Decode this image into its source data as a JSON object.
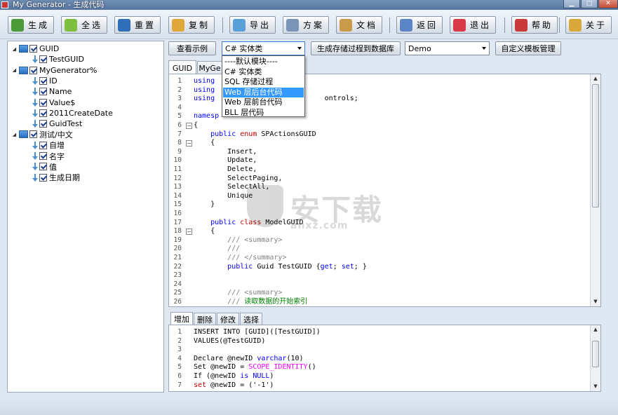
{
  "window": {
    "title": "My Generator - 生成代码"
  },
  "toolbar": {
    "buttons": [
      {
        "id": "generate",
        "label": "生成",
        "color": "#4a9a3a"
      },
      {
        "id": "select_all",
        "label": "全选",
        "color": "#7fbf3f"
      },
      {
        "id": "reset",
        "label": "重置",
        "color": "#2e6fb8"
      },
      {
        "id": "copy",
        "label": "复制",
        "color": "#e0a83a"
      },
      {
        "id": "export",
        "label": "导出",
        "color": "#5aa0d8"
      },
      {
        "id": "scheme",
        "label": "方案",
        "color": "#7a94b8"
      },
      {
        "id": "docs",
        "label": "文档",
        "color": "#c89a4a"
      },
      {
        "id": "back",
        "label": "返回",
        "color": "#5a86c8"
      },
      {
        "id": "exit",
        "label": "退出",
        "color": "#d83a4a"
      },
      {
        "id": "help",
        "label": "帮助",
        "color": "#c83a3a"
      },
      {
        "id": "about",
        "label": "关于",
        "color": "#d8a83a"
      }
    ]
  },
  "tree": {
    "nodes": [
      {
        "label": "GUID",
        "level": 0,
        "kind": "table",
        "expanded": true
      },
      {
        "label": "TestGUID",
        "level": 1,
        "kind": "field"
      },
      {
        "label": "MyGenerator%",
        "level": 0,
        "kind": "table",
        "expanded": true
      },
      {
        "label": "ID",
        "level": 1,
        "kind": "field"
      },
      {
        "label": "Name",
        "level": 1,
        "kind": "field"
      },
      {
        "label": "Value$",
        "level": 1,
        "kind": "field"
      },
      {
        "label": "2011CreateDate",
        "level": 1,
        "kind": "field"
      },
      {
        "label": "GuidTest",
        "level": 1,
        "kind": "field"
      },
      {
        "label": "测试/中文",
        "level": 0,
        "kind": "table",
        "expanded": true
      },
      {
        "label": "自增",
        "level": 1,
        "kind": "field"
      },
      {
        "label": "名字",
        "level": 1,
        "kind": "field"
      },
      {
        "label": "值",
        "level": 1,
        "kind": "field"
      },
      {
        "label": "生成日期",
        "level": 1,
        "kind": "field"
      }
    ]
  },
  "controls": {
    "view_sample": "查看示例",
    "template_combo": "C# 实体类",
    "gen_proc_button": "生成存储过程到数据库",
    "db_combo": "Demo",
    "custom_template_button": "自定义模板管理"
  },
  "dropdown": {
    "items": [
      "----默认模块----",
      "C# 实体类",
      "SQL 存储过程",
      "Web 层后台代码",
      "Web 层前台代码",
      "BLL 层代码"
    ],
    "highlighted_index": 3
  },
  "top_tabs": [
    "GUID",
    "MyGe"
  ],
  "code": {
    "lines": [
      {
        "n": "1",
        "fold": "",
        "segs": [
          [
            "kw",
            "using"
          ],
          [
            "",
            "  "
          ]
        ]
      },
      {
        "n": "2",
        "fold": "",
        "segs": [
          [
            "kw",
            "using"
          ]
        ]
      },
      {
        "n": "3",
        "fold": "",
        "segs": [
          [
            "kw",
            "using"
          ],
          [
            "",
            "                          ontrols;"
          ]
        ]
      },
      {
        "n": "4",
        "fold": "",
        "segs": []
      },
      {
        "n": "5",
        "fold": "",
        "segs": [
          [
            "kw",
            "namesp"
          ],
          [
            "",
            " "
          ]
        ]
      },
      {
        "n": "6",
        "fold": "−",
        "segs": [
          [
            "",
            "{"
          ]
        ]
      },
      {
        "n": "7",
        "fold": "",
        "segs": [
          [
            "",
            "    "
          ],
          [
            "kw",
            "public"
          ],
          [
            "",
            " "
          ],
          [
            "kw2",
            "enum"
          ],
          [
            "",
            " SPActionsGUID"
          ]
        ]
      },
      {
        "n": "8",
        "fold": "−",
        "segs": [
          [
            "",
            "    {"
          ]
        ]
      },
      {
        "n": "9",
        "fold": "",
        "segs": [
          [
            "",
            "        Insert,"
          ]
        ]
      },
      {
        "n": "10",
        "fold": "",
        "segs": [
          [
            "",
            "        Update,"
          ]
        ]
      },
      {
        "n": "11",
        "fold": "",
        "segs": [
          [
            "",
            "        Delete,"
          ]
        ]
      },
      {
        "n": "12",
        "fold": "",
        "segs": [
          [
            "",
            "        SelectPaging,"
          ]
        ]
      },
      {
        "n": "13",
        "fold": "",
        "segs": [
          [
            "",
            "        SelectAll,"
          ]
        ]
      },
      {
        "n": "14",
        "fold": "",
        "segs": [
          [
            "",
            "        Unique"
          ]
        ]
      },
      {
        "n": "15",
        "fold": "",
        "segs": [
          [
            "",
            "    }"
          ]
        ]
      },
      {
        "n": "16",
        "fold": "",
        "segs": []
      },
      {
        "n": "17",
        "fold": "",
        "segs": [
          [
            "",
            "    "
          ],
          [
            "kw",
            "public"
          ],
          [
            "",
            " "
          ],
          [
            "kw2",
            "class"
          ],
          [
            "",
            " ModelGUID"
          ]
        ]
      },
      {
        "n": "18",
        "fold": "−",
        "segs": [
          [
            "",
            "    {"
          ]
        ]
      },
      {
        "n": "19",
        "fold": "",
        "segs": [
          [
            "",
            "        "
          ],
          [
            "cm",
            "/// <summary>"
          ]
        ]
      },
      {
        "n": "20",
        "fold": "",
        "segs": [
          [
            "",
            "        "
          ],
          [
            "cm",
            "///"
          ]
        ]
      },
      {
        "n": "21",
        "fold": "",
        "segs": [
          [
            "",
            "        "
          ],
          [
            "cm",
            "/// </summary>"
          ]
        ]
      },
      {
        "n": "22",
        "fold": "",
        "segs": [
          [
            "",
            "        "
          ],
          [
            "kw",
            "public"
          ],
          [
            "",
            " Guid TestGUID {"
          ],
          [
            "kw",
            "get"
          ],
          [
            "",
            "; "
          ],
          [
            "kw",
            "set"
          ],
          [
            "",
            "; }"
          ]
        ]
      },
      {
        "n": "23",
        "fold": "",
        "segs": []
      },
      {
        "n": "24",
        "fold": "",
        "segs": []
      },
      {
        "n": "25",
        "fold": "",
        "segs": [
          [
            "",
            "        "
          ],
          [
            "cm",
            "/// <summary>"
          ]
        ]
      },
      {
        "n": "26",
        "fold": "",
        "segs": [
          [
            "",
            "        "
          ],
          [
            "cm",
            "/// "
          ],
          [
            "gr",
            "读取数据的开始索引"
          ]
        ]
      }
    ]
  },
  "bottom_tabs": [
    "增加",
    "删除",
    "修改",
    "选择"
  ],
  "sql": {
    "lines": [
      {
        "n": "1",
        "segs": [
          [
            "",
            "INSERT INTO [GUID]([TestGUID])"
          ]
        ]
      },
      {
        "n": "2",
        "segs": [
          [
            "",
            "VALUES(@TestGUID)"
          ]
        ]
      },
      {
        "n": "3",
        "segs": []
      },
      {
        "n": "4",
        "segs": [
          [
            "",
            "Declare @newID "
          ],
          [
            "kw",
            "varchar"
          ],
          [
            "",
            "(10)"
          ]
        ]
      },
      {
        "n": "5",
        "segs": [
          [
            "",
            "Set @newID = "
          ],
          [
            "mag",
            "SCOPE_IDENTITY"
          ],
          [
            "",
            "()"
          ]
        ]
      },
      {
        "n": "6",
        "segs": [
          [
            "",
            "If (@newID "
          ],
          [
            "kw",
            "is"
          ],
          [
            "",
            " "
          ],
          [
            "kw",
            "NULL"
          ],
          [
            "",
            ")"
          ]
        ]
      },
      {
        "n": "7",
        "segs": [
          [
            "kw2",
            "set"
          ],
          [
            "",
            " @newID = ('-1')"
          ]
        ]
      }
    ]
  },
  "watermark": {
    "main": "安下载",
    "sub": "anxz.com"
  }
}
